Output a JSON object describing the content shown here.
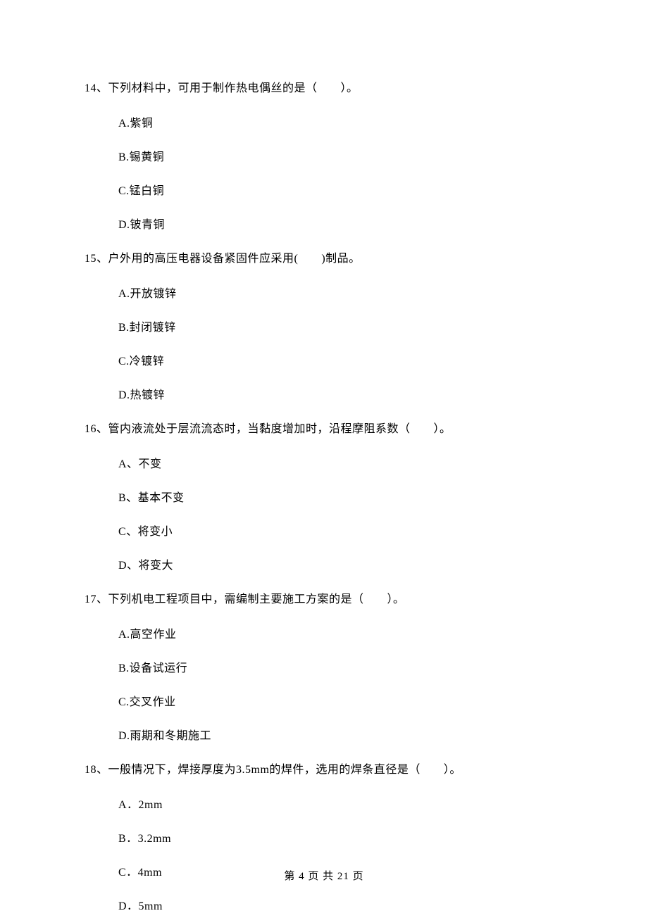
{
  "questions": [
    {
      "number": "14、",
      "text": "下列材料中，可用于制作热电偶丝的是（　　）。",
      "options": [
        "A.紫铜",
        "B.锡黄铜",
        "C.锰白铜",
        "D.铍青铜"
      ]
    },
    {
      "number": "15、",
      "text": "户外用的高压电器设备紧固件应采用(　　)制品。",
      "options": [
        "A.开放镀锌",
        "B.封闭镀锌",
        "C.冷镀锌",
        "D.热镀锌"
      ]
    },
    {
      "number": "16、",
      "text": "管内液流处于层流流态时，当黏度增加时，沿程摩阻系数（　　）。",
      "options": [
        "A、不变",
        "B、基本不变",
        "C、将变小",
        "D、将变大"
      ]
    },
    {
      "number": "17、",
      "text": "下列机电工程项目中，需编制主要施工方案的是（　　）。",
      "options": [
        "A.高空作业",
        "B.设备试运行",
        "C.交叉作业",
        "D.雨期和冬期施工"
      ]
    },
    {
      "number": "18、",
      "text": "一般情况下，焊接厚度为3.5mm的焊件，选用的焊条直径是（　　）。",
      "options": [
        "A．2mm",
        "B．3.2mm",
        "C．4mm",
        "D．5mm"
      ]
    }
  ],
  "footer": "第 4 页 共 21 页"
}
